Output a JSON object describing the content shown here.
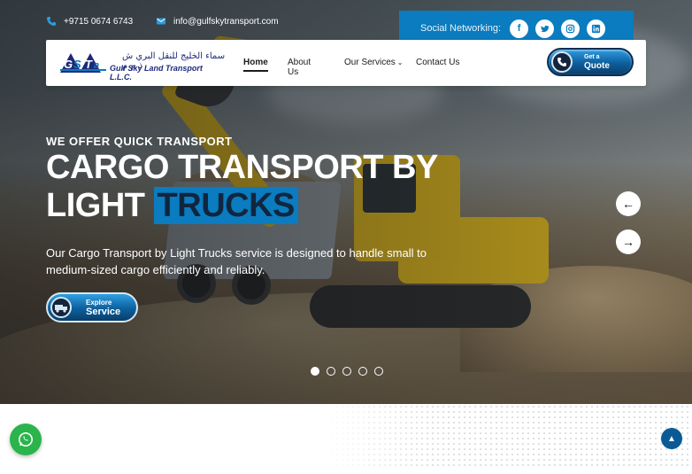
{
  "topbar": {
    "phone": "+9715 0674 6743",
    "email": "info@gulfskytransport.com",
    "social_label": "Social Networking:",
    "social_icons": [
      "facebook-icon",
      "twitter-icon",
      "instagram-icon",
      "linkedin-icon"
    ],
    "social_glyphs": [
      "f",
      "t",
      "◎",
      "in"
    ]
  },
  "brand": {
    "logo_mark": "GSTa",
    "arabic_name": "سماء الخليج للنقل البري ش ذ م م",
    "english_name": "Gulf Sky Land Transport L.L.C."
  },
  "nav": {
    "items": [
      "Home",
      "About Us",
      "Our Services",
      "Contact Us"
    ],
    "active": "Home"
  },
  "quote_button": {
    "line1": "Get a",
    "line2": "Quote"
  },
  "hero": {
    "tagline": "WE OFFER QUICK TRANSPORT",
    "headline_line1": "CARGO TRANSPORT BY",
    "headline_line2_prefix": "LIGHT",
    "headline_highlight": "TRUCKS",
    "description": "Our Cargo Transport by Light Trucks service is designed to handle small to medium-sized cargo efficiently and reliably.",
    "cta_line1": "Explore",
    "cta_line2": "Service",
    "slide_count": 5,
    "active_slide": 1
  },
  "colors": {
    "accent": "#0a7cbf",
    "whatsapp": "#2ab44b",
    "scroll_top": "#0a5a96"
  }
}
